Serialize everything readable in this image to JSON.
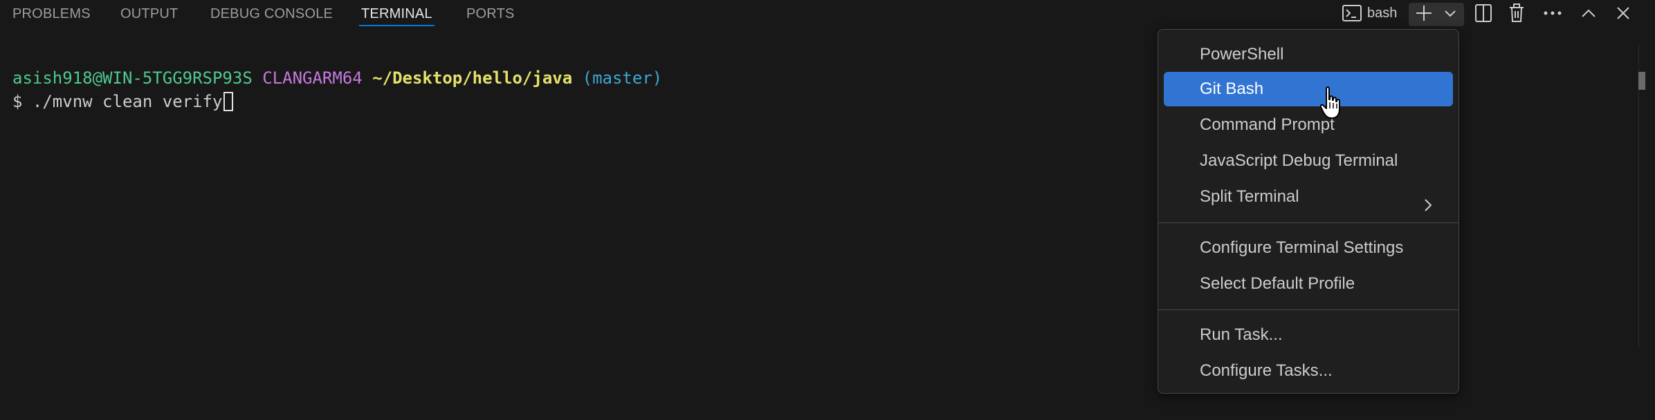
{
  "tabs": [
    {
      "label": "PROBLEMS",
      "active": false
    },
    {
      "label": "OUTPUT",
      "active": false
    },
    {
      "label": "DEBUG CONSOLE",
      "active": false
    },
    {
      "label": "TERMINAL",
      "active": true
    },
    {
      "label": "PORTS",
      "active": false
    }
  ],
  "toolbar": {
    "terminal_name": "bash",
    "icons": [
      "terminal-icon",
      "plus-icon",
      "chevron-down-icon",
      "split-icon",
      "trash-icon",
      "ellipsis-icon",
      "chevron-up-icon",
      "close-icon"
    ]
  },
  "terminal": {
    "prompt_user": "asish918@WIN-5TGG9RSP93S",
    "prompt_msystem": "CLANGARM64",
    "prompt_path": "~/Desktop/hello/java",
    "prompt_branch": "(master)",
    "prompt_symbol": "$",
    "command": "./mvnw clean verify"
  },
  "menu": {
    "items": [
      {
        "label": "PowerShell"
      },
      {
        "label": "Git Bash",
        "highlighted": true
      },
      {
        "label": "Command Prompt"
      },
      {
        "label": "JavaScript Debug Terminal"
      },
      {
        "label": "Split Terminal",
        "submenu": true
      },
      {
        "label": "Configure Terminal Settings"
      },
      {
        "label": "Select Default Profile"
      },
      {
        "label": "Run Task..."
      },
      {
        "label": "Configure Tasks..."
      }
    ]
  },
  "colors": {
    "background": "#181818",
    "accent": "#0078d4",
    "highlight": "#3274d1",
    "prompt_user": "#4ec98f",
    "prompt_msystem": "#c678dd",
    "prompt_path": "#e5e26a",
    "prompt_branch": "#3ea7d4"
  }
}
